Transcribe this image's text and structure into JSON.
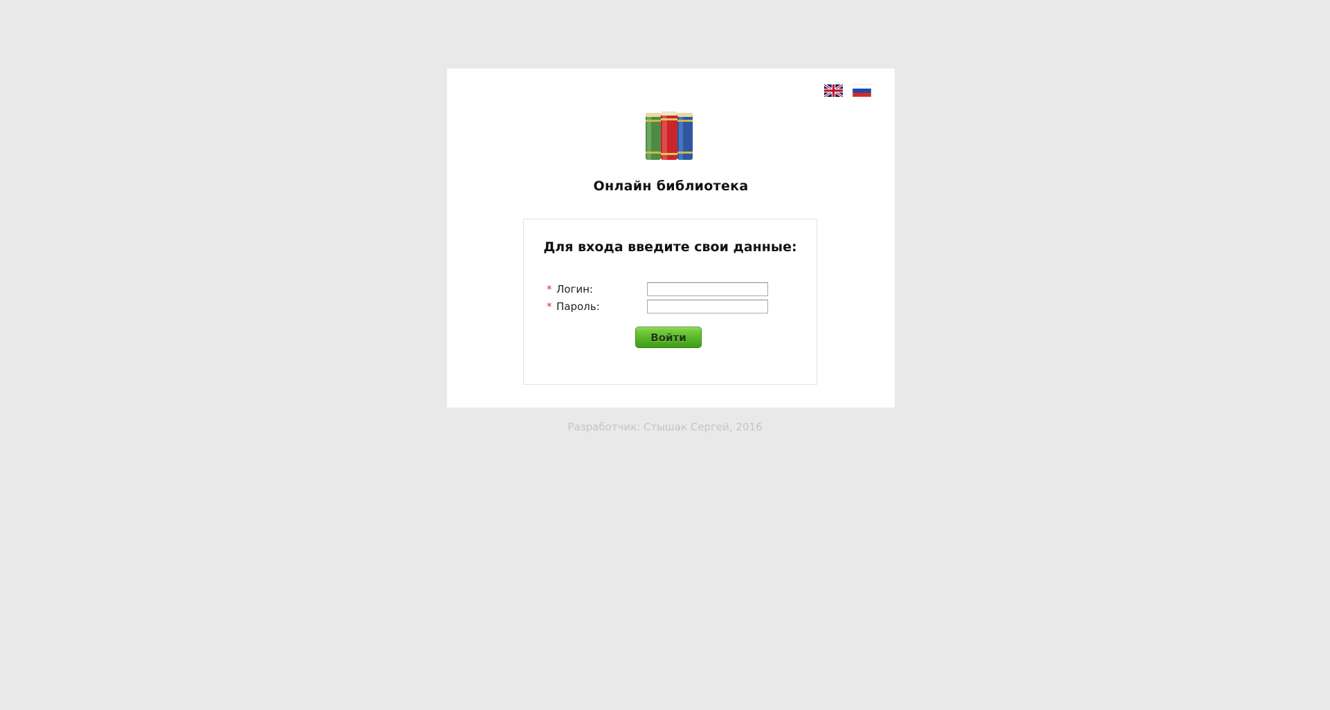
{
  "header": {
    "site_title": "Онлайн библиотека",
    "flags": [
      {
        "name": "english-flag-icon",
        "lang": "en"
      },
      {
        "name": "russian-flag-icon",
        "lang": "ru"
      }
    ],
    "logo_icon": "books-icon"
  },
  "login_form": {
    "heading": "Для входа введите свои данные:",
    "required_marker": "*",
    "login_label": "Логин:",
    "login_value": "",
    "password_label": "Пароль:",
    "password_value": "",
    "submit_label": "Войти"
  },
  "footer": {
    "text": "Разработчик: Стышак Сергей, 2016"
  },
  "colors": {
    "background": "#e9e9e9",
    "card": "#ffffff",
    "required": "#d9302c",
    "submit_green": "#58b52a",
    "footer_text": "#c4c4c4"
  }
}
